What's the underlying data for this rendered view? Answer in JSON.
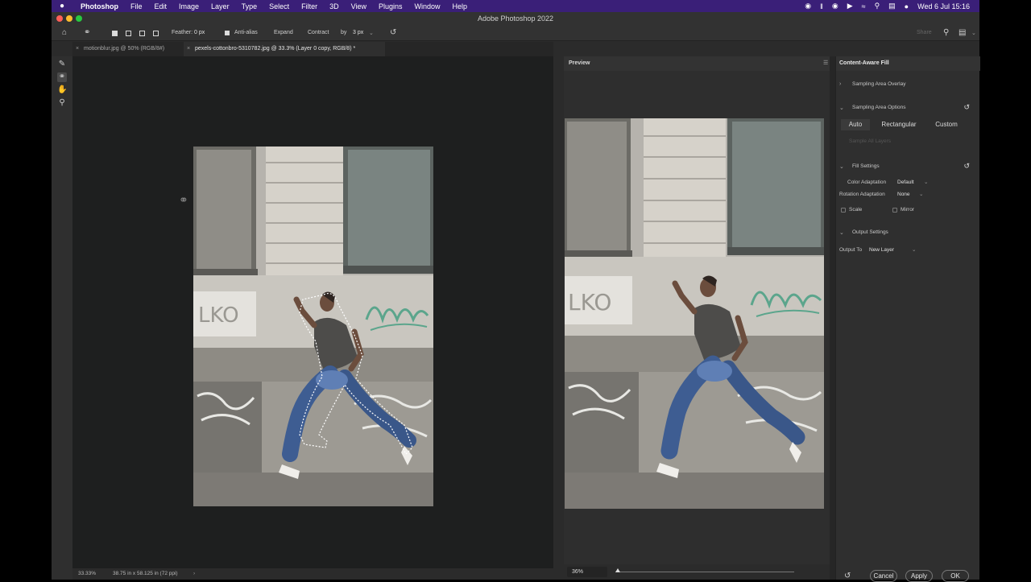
{
  "menubar": {
    "app_name": "Photoshop",
    "items": [
      "File",
      "Edit",
      "Image",
      "Layer",
      "Type",
      "Select",
      "Filter",
      "3D",
      "View",
      "Plugins",
      "Window",
      "Help"
    ],
    "clock": "Wed 6 Jul  15:16"
  },
  "window": {
    "title": "Adobe Photoshop 2022"
  },
  "options_bar": {
    "feather_label": "Feather:",
    "feather_value": "0 px",
    "antialias_label": "Anti-alias",
    "expand_label": "Expand",
    "contract_label": "Contract",
    "by_label": "by",
    "by_value": "3 px",
    "share_label": "Share"
  },
  "tabs": [
    {
      "label": "motionblur.jpg @ 50% (RGB/8#)"
    },
    {
      "label": "pexels-cottonbro-5310782.jpg @ 33.3% (Layer 0 copy, RGB/8) *"
    }
  ],
  "status": {
    "zoom": "33.33%",
    "dimensions": "38.75 in x 58.125 in (72 ppi)"
  },
  "preview": {
    "label": "Preview",
    "zoom": "36%",
    "zoom_fraction": 0.0
  },
  "caf": {
    "title": "Content-Aware Fill",
    "sampling_overlay": "Sampling Area Overlay",
    "sampling_options": "Sampling Area Options",
    "sampling_modes": [
      "Auto",
      "Rectangular",
      "Custom"
    ],
    "selected_mode": "Auto",
    "sample_all_layers": "Sample All Layers",
    "fill_settings": "Fill Settings",
    "color_adaptation_label": "Color Adaptation",
    "color_adaptation_value": "Default",
    "rotation_adaptation_label": "Rotation Adaptation",
    "rotation_adaptation_value": "None",
    "scale_label": "Scale",
    "mirror_label": "Mirror",
    "output_settings": "Output Settings",
    "output_to_label": "Output To",
    "output_to_value": "New Layer",
    "cancel": "Cancel",
    "apply": "Apply",
    "ok": "OK"
  }
}
